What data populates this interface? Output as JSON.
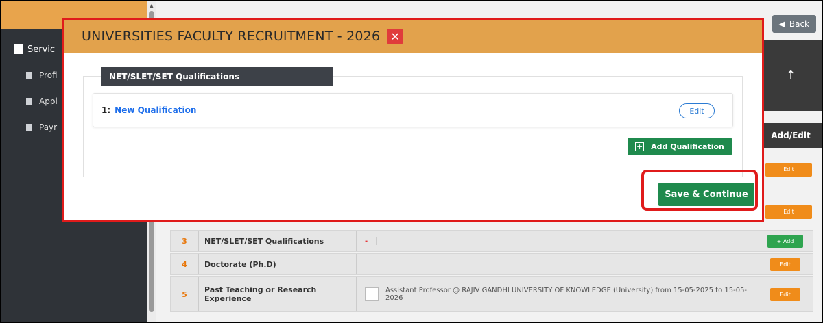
{
  "sidebar": {
    "section_label": "Servic",
    "items": [
      {
        "label": "Profi"
      },
      {
        "label": "Appl"
      },
      {
        "label": "Payr"
      }
    ]
  },
  "page": {
    "back_label": "Back",
    "add_edit_header": "Add/Edit",
    "rows": [
      {
        "num": "3",
        "name": "NET/SLET/SET Qualifications",
        "detail": "-",
        "action": "+ Add"
      },
      {
        "num": "4",
        "name": "Doctorate (Ph.D)",
        "detail": "",
        "action": "Edit"
      },
      {
        "num": "5",
        "name": "Past Teaching or Research Experience",
        "detail": "Assistant Professor @ RAJIV GANDHI UNIVERSITY OF KNOWLEDGE (University) from 15-05-2025 to 15-05-2026",
        "action": "Edit"
      }
    ],
    "partial_edit_labels": [
      "Edit",
      "Edit"
    ]
  },
  "modal": {
    "title": "UNIVERSITIES FACULTY RECRUITMENT - 2026",
    "close_icon": "x-icon",
    "section_title": "NET/SLET/SET Qualifications",
    "qualification": {
      "index": "1:",
      "name": "New Qualification",
      "edit_label": "Edit"
    },
    "add_button_label": "Add Qualification",
    "save_button_label": "Save & Continue"
  },
  "colors": {
    "modal_header": "#e2a24c",
    "highlight_border": "#e01b1b",
    "primary_green": "#1f8a4d",
    "edit_orange": "#f08c1a"
  }
}
